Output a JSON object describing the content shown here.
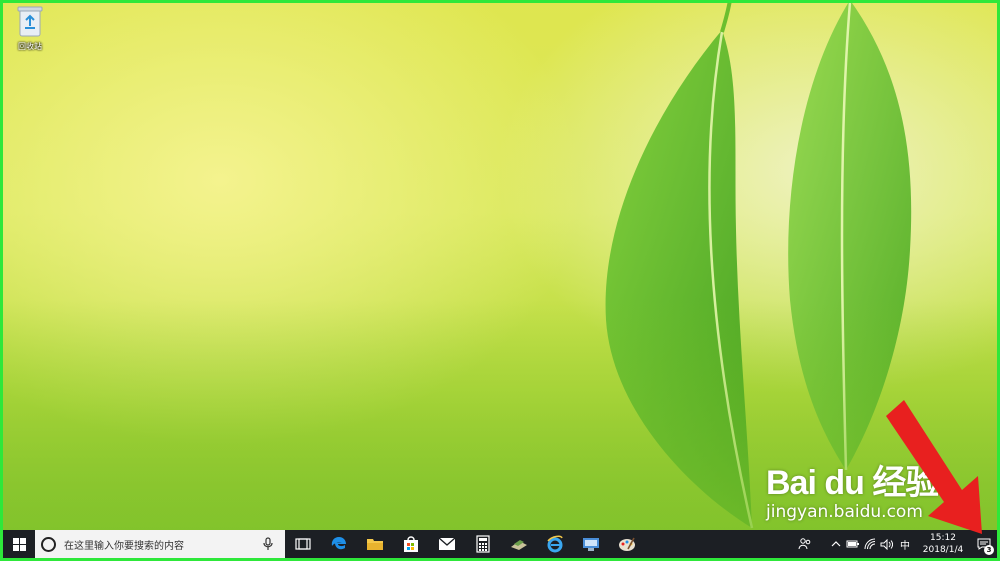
{
  "desktop": {
    "icons": [
      {
        "label": "回收站",
        "icon": "recycle-bin-icon"
      }
    ]
  },
  "taskbar": {
    "search_placeholder": "在这里输入你要搜索的内容",
    "pinned": [
      {
        "name": "task-view",
        "icon": "task-view-icon"
      },
      {
        "name": "edge",
        "icon": "edge-icon"
      },
      {
        "name": "file-explorer",
        "icon": "folder-icon"
      },
      {
        "name": "store",
        "icon": "store-bag-icon"
      },
      {
        "name": "mail",
        "icon": "mail-icon"
      },
      {
        "name": "calculator",
        "icon": "calculator-icon"
      },
      {
        "name": "app",
        "icon": "app-icon"
      },
      {
        "name": "internet-explorer",
        "icon": "ie-icon"
      },
      {
        "name": "app-2",
        "icon": "app-icon"
      },
      {
        "name": "paint",
        "icon": "paint-icon"
      }
    ],
    "tray": {
      "ime": "中",
      "time": "15:12",
      "date": "2018/1/4",
      "notification_count": "3"
    }
  },
  "watermark": {
    "brand": "Bai du 经验",
    "url": "jingyan.baidu.com"
  },
  "colors": {
    "frame": "#2ee83a",
    "taskbar": "#1c1f24",
    "arrow": "#e8201f"
  }
}
